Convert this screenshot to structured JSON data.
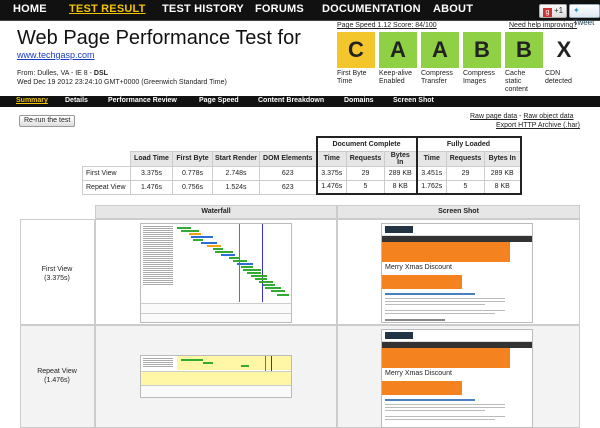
{
  "topnav": {
    "items": [
      {
        "label": "HOME",
        "active": false
      },
      {
        "label": "TEST RESULT",
        "active": true
      },
      {
        "label": "TEST HISTORY",
        "active": false
      },
      {
        "label": "FORUMS",
        "active": false
      },
      {
        "label": "DOCUMENTATION",
        "active": false
      },
      {
        "label": "ABOUT",
        "active": false
      }
    ],
    "gplus_label": "+1",
    "tweet_label": "Tweet"
  },
  "header": {
    "title": "Web Page Performance Test for",
    "site": "www.techgasp.com",
    "from_prefix": "From: ",
    "from_location": "Dulles, VA",
    "from_mid": " - IE 8 - ",
    "from_conn": "DSL",
    "date": "Wed Dec 19 2012 23:24:10 GMT+0000 (Greenwich Standard Time)"
  },
  "pagespeed": {
    "label": "Page Speed 1.12 Score: 84/100",
    "help": "Need help improving?"
  },
  "grades": [
    {
      "letter": "C",
      "label": "First Byte Time",
      "color": "#f3c62c"
    },
    {
      "letter": "A",
      "label": "Keep-alive Enabled",
      "color": "#8fd045"
    },
    {
      "letter": "A",
      "label": "Compress Transfer",
      "color": "#8fd045"
    },
    {
      "letter": "B",
      "label": "Compress Images",
      "color": "#8fd045"
    },
    {
      "letter": "B",
      "label": "Cache static content",
      "color": "#8fd045"
    },
    {
      "letter": "X",
      "label": "CDN detected",
      "color": "#ffffff"
    }
  ],
  "tabs": [
    {
      "label": "Summary",
      "active": true
    },
    {
      "label": "Details",
      "active": false
    },
    {
      "label": "Performance Review",
      "active": false
    },
    {
      "label": "Page Speed",
      "active": false
    },
    {
      "label": "Content Breakdown",
      "active": false
    },
    {
      "label": "Domains",
      "active": false
    },
    {
      "label": "Screen Shot",
      "active": false
    }
  ],
  "actions": {
    "rerun": "Re-run the test",
    "raw_page": "Raw page data",
    "raw_sep": " - ",
    "raw_object": "Raw object data",
    "export": "Export HTTP Archive (.har)"
  },
  "results": {
    "group_doc": "Document Complete",
    "group_full": "Fully Loaded",
    "columns": [
      "Load Time",
      "First Byte",
      "Start Render",
      "DOM Elements",
      "Time",
      "Requests",
      "Bytes In",
      "Time",
      "Requests",
      "Bytes In"
    ],
    "rows": [
      {
        "label": "First View",
        "cells": [
          "3.375s",
          "0.778s",
          "2.748s",
          "623",
          "3.375s",
          "29",
          "289 KB",
          "3.451s",
          "29",
          "289 KB"
        ]
      },
      {
        "label": "Repeat View",
        "cells": [
          "1.476s",
          "0.756s",
          "1.524s",
          "623",
          "1.476s",
          "5",
          "8 KB",
          "1.762s",
          "5",
          "8 KB"
        ]
      }
    ]
  },
  "panels": {
    "waterfall_header": "Waterfall",
    "screenshot_header": "Screen Shot",
    "first_view_label": "First View",
    "first_view_time": "(3.375s)",
    "repeat_view_label": "Repeat View",
    "repeat_view_time": "(1.476s)",
    "screenshot_caption": "Merry Xmas Discount"
  }
}
